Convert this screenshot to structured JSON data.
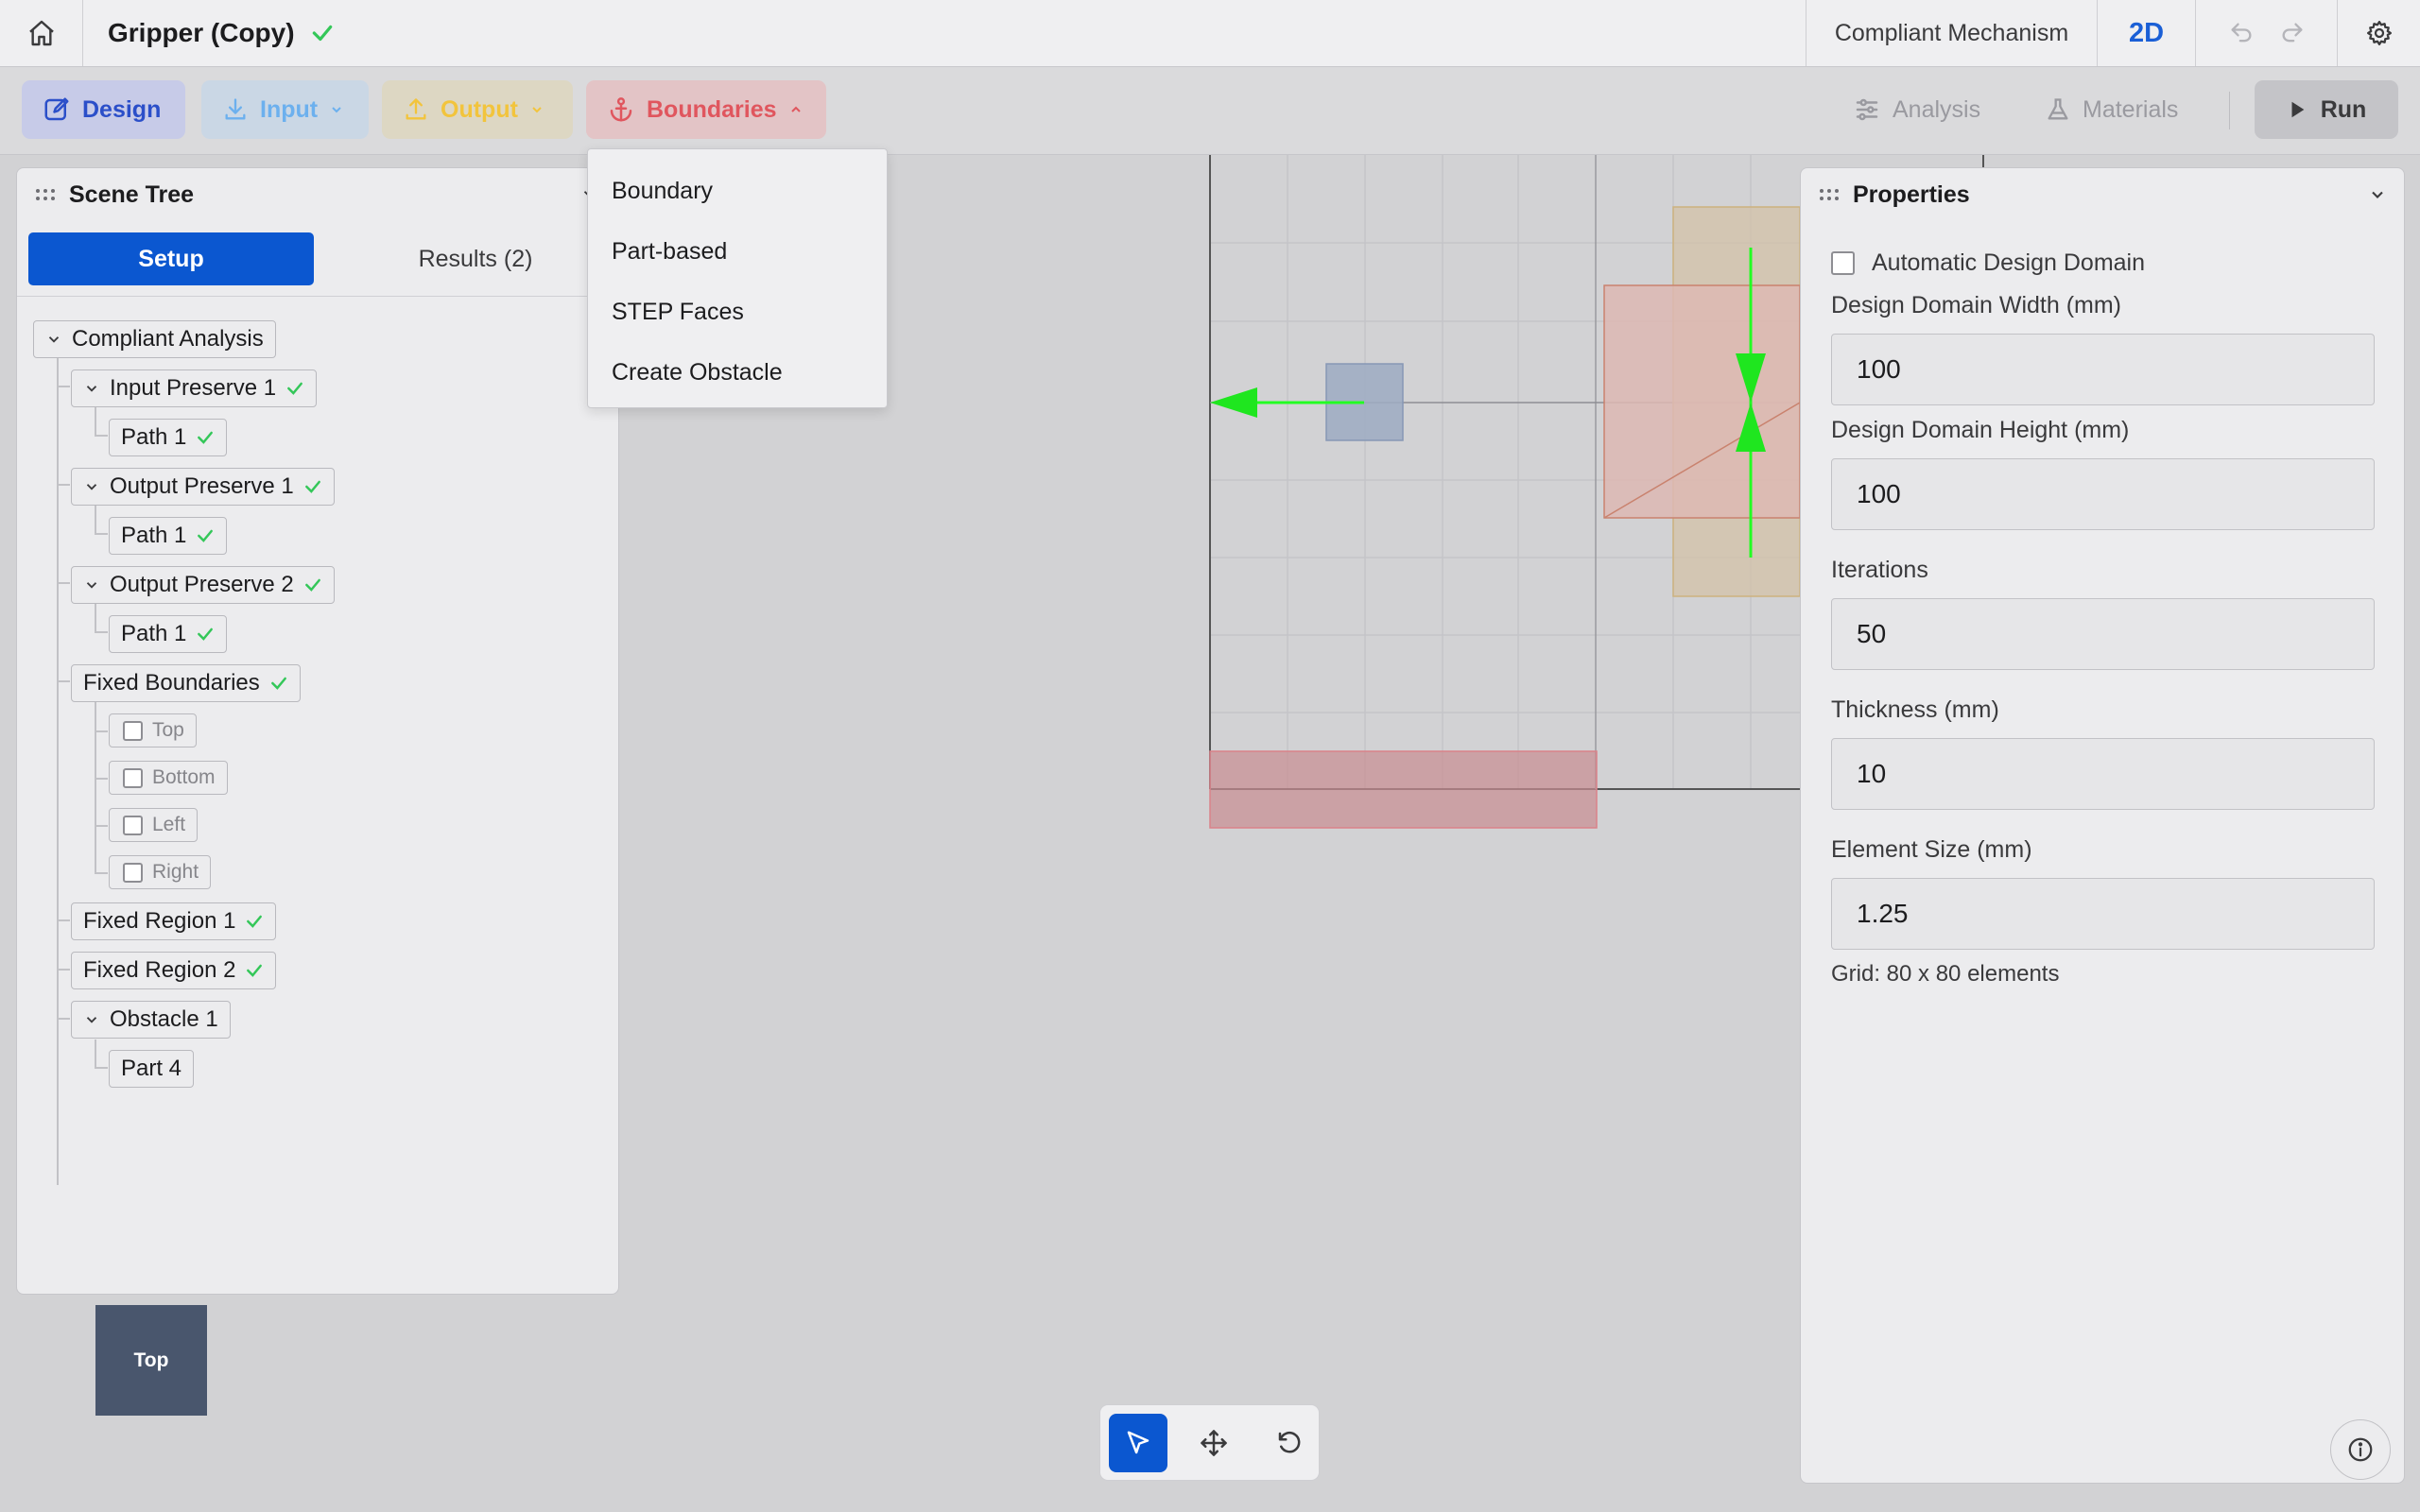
{
  "header": {
    "doc_title": "Gripper (Copy)",
    "mode": "Compliant Mechanism",
    "view_mode": "2D"
  },
  "toolbar": {
    "design": "Design",
    "input": "Input",
    "output": "Output",
    "boundaries": "Boundaries",
    "analysis": "Analysis",
    "materials": "Materials",
    "run": "Run"
  },
  "boundaries_menu": {
    "items": [
      "Boundary",
      "Part-based",
      "STEP Faces",
      "Create Obstacle"
    ]
  },
  "scene_tree": {
    "title": "Scene Tree",
    "tabs": {
      "setup": "Setup",
      "results": "Results (2)"
    },
    "nodes": {
      "root": "Compliant Analysis",
      "input_preserve": "Input Preserve 1",
      "input_path": "Path 1",
      "output_preserve_1": "Output Preserve 1",
      "output_path_1": "Path 1",
      "output_preserve_2": "Output Preserve 2",
      "output_path_2": "Path 1",
      "fixed_boundaries": "Fixed Boundaries",
      "fb_top": "Top",
      "fb_bottom": "Bottom",
      "fb_left": "Left",
      "fb_right": "Right",
      "fixed_region_1": "Fixed Region 1",
      "fixed_region_2": "Fixed Region 2",
      "obstacle": "Obstacle 1",
      "obstacle_part": "Part 4"
    }
  },
  "view_cube": {
    "label": "Top"
  },
  "properties": {
    "title": "Properties",
    "auto_domain_label": "Automatic Design Domain",
    "auto_domain_checked": false,
    "width_label": "Design Domain Width (mm)",
    "width_value": "100",
    "height_label": "Design Domain Height (mm)",
    "height_value": "100",
    "iterations_label": "Iterations",
    "iterations_value": "50",
    "thickness_label": "Thickness (mm)",
    "thickness_value": "10",
    "element_label": "Element Size (mm)",
    "element_value": "1.25",
    "grid_note": "Grid: 80 x 80 elements"
  },
  "colors": {
    "primary": "#0b57d0",
    "check": "#34c759",
    "arrow": "#22ff22",
    "boundaries_accent": "#e0565e"
  }
}
